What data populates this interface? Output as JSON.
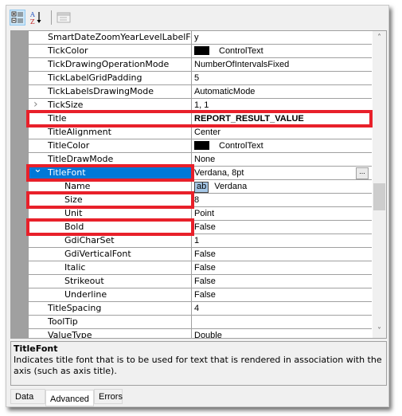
{
  "toolbar": {
    "buttons": [
      {
        "icon": "categorized-icon",
        "active": true
      },
      {
        "icon": "alphabetical-sort-icon",
        "active": false
      },
      {
        "icon": "property-pages-icon",
        "active": false
      }
    ]
  },
  "properties": [
    {
      "name": "SmartDateZoomYearLevelLabelForr",
      "value": "y"
    },
    {
      "name": "TickColor",
      "value": "ControlText",
      "swatch": "#000000"
    },
    {
      "name": "TickDrawingOperationMode",
      "value": "NumberOfIntervalsFixed"
    },
    {
      "name": "TickLabelGridPadding",
      "value": "5"
    },
    {
      "name": "TickLabelsDrawingMode",
      "value": "AutomaticMode"
    },
    {
      "name": "TickSize",
      "value": "1, 1",
      "expander": "collapsed"
    },
    {
      "name": "Title",
      "value": "REPORT_RESULT_VALUE",
      "bold": true,
      "highlighted": true
    },
    {
      "name": "TitleAlignment",
      "value": "Center"
    },
    {
      "name": "TitleColor",
      "value": "ControlText",
      "swatch": "#000000"
    },
    {
      "name": "TitleDrawMode",
      "value": "None"
    },
    {
      "name": "TitleFont",
      "value": "Verdana, 8pt",
      "expander": "expanded",
      "selected": true,
      "highlighted": true,
      "has_ellipsis": true
    },
    {
      "name": "Name",
      "value": "Verdana",
      "child": true,
      "font_preview": "ab"
    },
    {
      "name": "Size",
      "value": "8",
      "child": true,
      "highlighted": true
    },
    {
      "name": "Unit",
      "value": "Point",
      "child": true
    },
    {
      "name": "Bold",
      "value": "False",
      "child": true,
      "highlighted": true
    },
    {
      "name": "GdiCharSet",
      "value": "1",
      "child": true
    },
    {
      "name": "GdiVerticalFont",
      "value": "False",
      "child": true
    },
    {
      "name": "Italic",
      "value": "False",
      "child": true
    },
    {
      "name": "Strikeout",
      "value": "False",
      "child": true
    },
    {
      "name": "Underline",
      "value": "False",
      "child": true
    },
    {
      "name": "TitleSpacing",
      "value": "4"
    },
    {
      "name": "ToolTip",
      "value": ""
    },
    {
      "name": "ValueType",
      "value": "Double"
    }
  ],
  "ellipsis_label": "...",
  "scrollbar": {
    "up": "˄",
    "down": "˅",
    "position_fraction": 0.55
  },
  "description": {
    "title": "TitleFont",
    "body": "Indicates title font that is to be used for text that is rendered in association with the axis (such as axis title)."
  },
  "tabs": [
    {
      "label": "Data",
      "active": false
    },
    {
      "label": "Advanced",
      "active": true
    },
    {
      "label": "Errors",
      "active": false
    }
  ],
  "highlight_color": "#e8202a",
  "selection_color": "#0078d7"
}
